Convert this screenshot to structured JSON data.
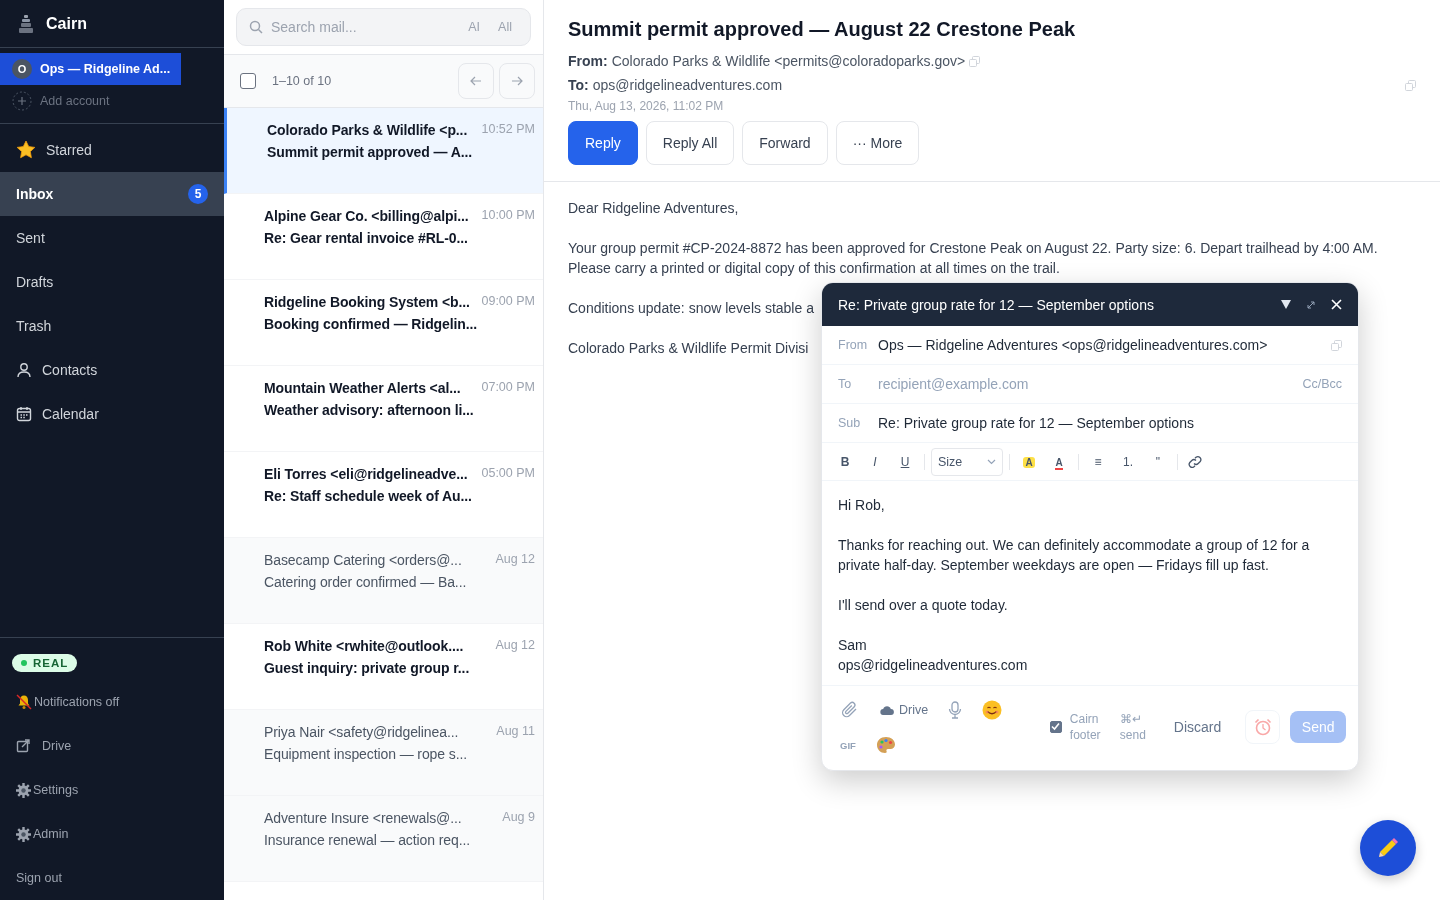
{
  "app": {
    "name": "Cairn"
  },
  "accounts": [
    {
      "initial": "O",
      "label": "Ops — Ridgeline Ad...",
      "selected": true
    }
  ],
  "add_account": "Add account",
  "nav": [
    {
      "kind": "starred",
      "label": "Starred",
      "selected": false
    },
    {
      "kind": "inbox",
      "label": "Inbox",
      "badge": "5",
      "selected": true
    },
    {
      "kind": "plain",
      "label": "Sent",
      "selected": false
    },
    {
      "kind": "plain",
      "label": "Drafts",
      "selected": false
    },
    {
      "kind": "plain",
      "label": "Trash",
      "selected": false
    },
    {
      "kind": "contacts",
      "label": "Contacts",
      "selected": false
    },
    {
      "kind": "calendar",
      "label": "Calendar",
      "selected": false
    }
  ],
  "mode_badge": "REAL",
  "footer_links": [
    {
      "kind": "bell-off",
      "label": "Notifications off"
    },
    {
      "kind": "external",
      "label": "Drive"
    },
    {
      "kind": "gear",
      "label": "Settings"
    },
    {
      "kind": "gear",
      "label": "Admin"
    },
    {
      "kind": "plain",
      "label": "Sign out"
    }
  ],
  "search": {
    "placeholder": "Search mail...",
    "toggles": [
      "AI",
      "All"
    ]
  },
  "list_toolbar": {
    "checked": false,
    "range": "1–10 of 10"
  },
  "emails": [
    {
      "sender": "Colorado Parks & Wildlife <p...",
      "subject": "Summit permit approved — A...",
      "time": "10:52 PM",
      "unread": true,
      "selected": true
    },
    {
      "sender": "Alpine Gear Co. <billing@alpi...",
      "subject": "Re: Gear rental invoice #RL-0...",
      "time": "10:00 PM",
      "unread": true,
      "selected": false
    },
    {
      "sender": "Ridgeline Booking System <b...",
      "subject": "Booking confirmed — Ridgelin...",
      "time": "09:00 PM",
      "unread": true,
      "selected": false
    },
    {
      "sender": "Mountain Weather Alerts <al...",
      "subject": "Weather advisory: afternoon li...",
      "time": "07:00 PM",
      "unread": true,
      "selected": false
    },
    {
      "sender": "Eli Torres <eli@ridgelineadve...",
      "subject": "Re: Staff schedule week of Au...",
      "time": "05:00 PM",
      "unread": true,
      "selected": false
    },
    {
      "sender": "Basecamp Catering <orders@...",
      "subject": "Catering order confirmed — Ba...",
      "time": "Aug 12",
      "unread": false,
      "selected": false
    },
    {
      "sender": "Rob White <rwhite@outlook....",
      "subject": "Guest inquiry: private group r...",
      "time": "Aug 12",
      "unread": true,
      "selected": false
    },
    {
      "sender": "Priya Nair <safety@ridgelinea...",
      "subject": "Equipment inspection — rope s...",
      "time": "Aug 11",
      "unread": false,
      "selected": false
    },
    {
      "sender": "Adventure Insure <renewals@...",
      "subject": "Insurance renewal — action req...",
      "time": "Aug 9",
      "unread": false,
      "selected": false
    }
  ],
  "message": {
    "title": "Summit permit approved — August 22 Crestone Peak",
    "from_label": "From:",
    "from": "Colorado Parks & Wildlife <permits@coloradoparks.gov>",
    "to_label": "To:",
    "to": "ops@ridgelineadventures.com",
    "date": "Thu, Aug 13, 2026, 11:02 PM",
    "actions": [
      {
        "label": "Reply",
        "primary": true
      },
      {
        "label": "Reply All",
        "primary": false
      },
      {
        "label": "Forward",
        "primary": false
      },
      {
        "label": "··· More",
        "primary": false
      }
    ],
    "body": [
      "Dear Ridgeline Adventures,",
      "Your group permit #CP-2024-8872 has been approved for Crestone Peak on August 22. Party size: 6. Depart trailhead by 4:00 AM. Please carry a printed or digital copy of this confirmation at all times on the trail.",
      "Conditions update: snow levels stable a",
      "Colorado Parks & Wildlife Permit Divisi"
    ]
  },
  "compose": {
    "title": "Re: Private group rate for 12 — September options",
    "from_label": "From",
    "from": "Ops — Ridgeline Adventures <ops@ridgelineadventures.com>",
    "to_label": "To",
    "to_placeholder": "recipient@example.com",
    "cc_bcc": "Cc/Bcc",
    "subject_label": "Sub",
    "subject": "Re: Private group rate for 12 — September options",
    "toolbar": [
      {
        "kind": "bold",
        "label": "B"
      },
      {
        "kind": "italic",
        "label": "I"
      },
      {
        "kind": "underline",
        "label": "U"
      },
      {
        "kind": "divider"
      },
      {
        "kind": "select",
        "label": "Size"
      },
      {
        "kind": "divider"
      },
      {
        "kind": "highlight",
        "label": "A"
      },
      {
        "kind": "color",
        "label": "A"
      },
      {
        "kind": "divider"
      },
      {
        "kind": "plain",
        "label": "≡"
      },
      {
        "kind": "plain",
        "label": "1."
      },
      {
        "kind": "plain",
        "label": "\""
      },
      {
        "kind": "divider"
      },
      {
        "kind": "link"
      }
    ],
    "body": [
      [
        "Hi Rob,"
      ],
      [
        "Thanks for reaching out. We can definitely accommodate a group of 12 for a private half-day. September weekdays are open — Fridays fill up fast."
      ],
      [
        "I'll send over a quote today."
      ],
      [
        "Sam",
        "ops@ridgelineadventures.com"
      ]
    ],
    "drive": "Drive",
    "gif": "GIF",
    "footer_checked": true,
    "footer_label": "Cairn footer",
    "shortcut": "⌘↵ send",
    "discard": "Discard",
    "send": "Send",
    "send_disabled": true
  }
}
